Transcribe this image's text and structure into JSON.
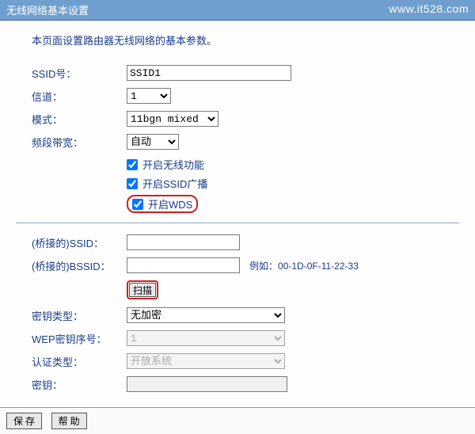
{
  "watermark": "www.it528.com",
  "header": "无线网络基本设置",
  "description": "本页面设置路由器无线网络的基本参数。",
  "fields": {
    "ssid_label": "SSID号：",
    "ssid_value": "SSID1",
    "channel_label": "信道：",
    "channel_value": "1",
    "mode_label": "模式：",
    "mode_value": "11bgn mixed",
    "bandwidth_label": "频段带宽：",
    "bandwidth_value": "自动"
  },
  "checkboxes": {
    "enable_wireless": "开启无线功能",
    "enable_ssid_broadcast": "开启SSID广播",
    "enable_wds": "开启WDS"
  },
  "bridge": {
    "ssid_label": "(桥接的)SSID：",
    "bssid_label": "(桥接的)BSSID：",
    "example_prefix": "例如：",
    "example_mac": "00-1D-0F-11-22-33",
    "scan_btn": "扫描",
    "key_type_label": "密钥类型：",
    "key_type_value": "无加密",
    "wep_index_label": "WEP密钥序号：",
    "wep_index_value": "1",
    "auth_type_label": "认证类型：",
    "auth_type_value": "开放系统",
    "key_label": "密钥："
  },
  "footer": {
    "save": "保 存",
    "help": "帮 助"
  }
}
